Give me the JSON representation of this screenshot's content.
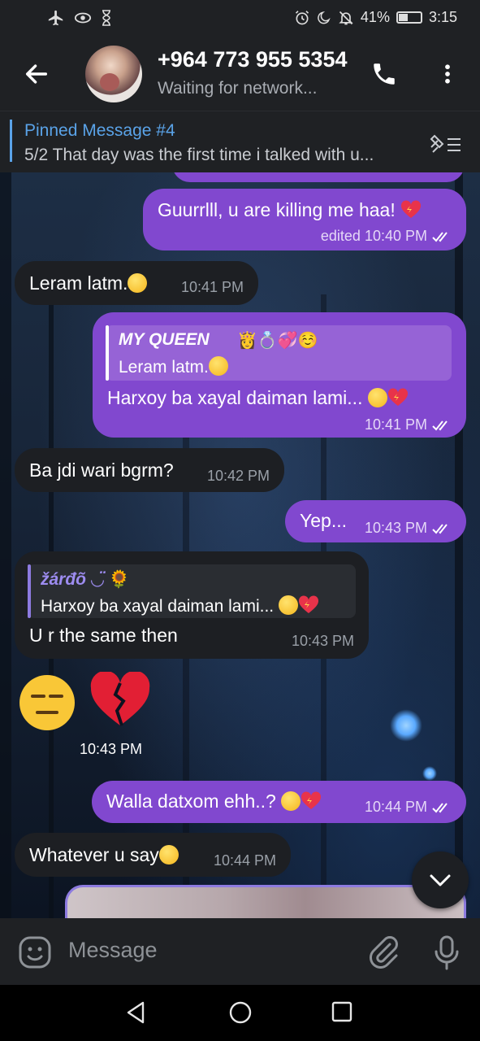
{
  "status_bar": {
    "left_icons": [
      "airplane-icon",
      "eye-icon",
      "hourglass-icon"
    ],
    "battery": "41%",
    "battery_level": 0.41,
    "time": "3:15"
  },
  "header": {
    "contact_name": "+964 773 955 5354",
    "status": "Waiting for network..."
  },
  "pinned": {
    "title": "Pinned Message #4",
    "preview": "5/2  That day was the first time i talked with u..."
  },
  "messages": [
    {
      "id": "m1",
      "dir": "out",
      "text": "Guurrlll, u are killing me haa!",
      "edited": "edited",
      "time": "10:40 PM"
    },
    {
      "id": "m2",
      "dir": "in",
      "text": "Leram latm.",
      "time": "10:41 PM"
    },
    {
      "id": "m3",
      "dir": "out",
      "reply_name": "MY QUEEN",
      "reply_text": "Leram latm.",
      "text": "Harxoy ba xayal daiman lami...",
      "time": "10:41 PM"
    },
    {
      "id": "m4",
      "dir": "in",
      "text": "Ba jdi wari bgrm?",
      "time": "10:42 PM"
    },
    {
      "id": "m5",
      "dir": "out",
      "text": "Yep...",
      "time": "10:43 PM"
    },
    {
      "id": "m6",
      "dir": "in",
      "reply_name": "žárđõ ◡̈",
      "reply_text": "Harxoy ba xayal daiman lami...",
      "text": "U r the same then",
      "time": "10:43 PM"
    },
    {
      "id": "m7",
      "dir": "in",
      "sticker": "😑 💔",
      "time": "10:43 PM"
    },
    {
      "id": "m8",
      "dir": "out",
      "text": "Walla datxom ehh..?",
      "time": "10:44 PM"
    },
    {
      "id": "m9",
      "dir": "in",
      "text": "Whatever u say",
      "time": "10:44 PM"
    }
  ],
  "input": {
    "placeholder": "Message"
  },
  "colors": {
    "outgoing_bubble": "#8148cf",
    "incoming_bubble": "#1d1f23",
    "accent": "#5aa3e8"
  }
}
